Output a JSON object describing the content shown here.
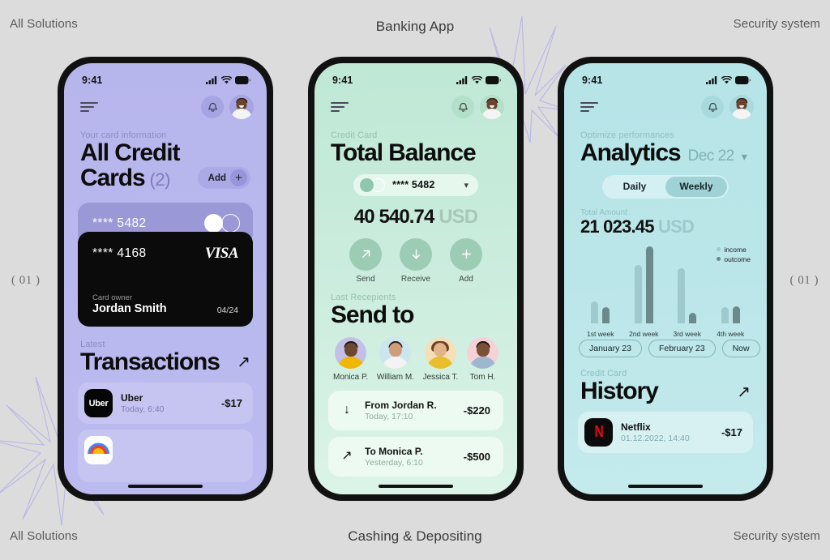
{
  "page": {
    "background": "#dcdcdc",
    "top_left": "All Solutions",
    "top_center": "Banking App",
    "top_right": "Security system",
    "bottom_left": "All Solutions",
    "bottom_center": "Cashing & Depositing",
    "bottom_right": "Security system",
    "index_left": "( 01 )",
    "index_right": "( 01 )"
  },
  "phone1": {
    "status": {
      "time": "9:41"
    },
    "eyebrow": "Your card information",
    "title_line1": "All Credit",
    "title_line2": "Cards",
    "count": "(2)",
    "add_label": "Add",
    "add_icon": "+",
    "card_top": {
      "number": "**** 5482"
    },
    "card_black": {
      "number": "**** 4168",
      "brand": "VISA",
      "owner_label": "Card owner",
      "owner": "Jordan Smith",
      "expiry": "04/24"
    },
    "section_eyebrow": "Latest",
    "section_title": "Transactions",
    "transactions": [
      {
        "name": "Uber",
        "time": "Today, 6:40",
        "amount": "-$17",
        "icon": "uber-logo"
      },
      {
        "name": "",
        "time": "",
        "amount": "",
        "icon": "gpay-logo"
      }
    ]
  },
  "phone2": {
    "status": {
      "time": "9:41"
    },
    "eyebrow": "Credit Card",
    "title": "Total Balance",
    "card_selector": {
      "number": "**** 5482"
    },
    "balance_value": "40 540.74",
    "balance_currency": "USD",
    "actions": [
      {
        "label": "Send",
        "icon": "arrow-up-right-icon"
      },
      {
        "label": "Receive",
        "icon": "arrow-down-icon"
      },
      {
        "label": "Add",
        "icon": "plus-icon"
      }
    ],
    "section_eyebrow": "Last Recepients",
    "section_title": "Send to",
    "recipients": [
      {
        "name": "Monica P."
      },
      {
        "name": "William M."
      },
      {
        "name": "Jessica T."
      },
      {
        "name": "Tom H."
      }
    ],
    "transactions": [
      {
        "arrow": "↓",
        "name": "From Jordan R.",
        "time": "Today, 17:10",
        "amount": "-$220"
      },
      {
        "arrow": "↗",
        "name": "To Monica P.",
        "time": "Yesterday, 6:10",
        "amount": "-$500"
      }
    ]
  },
  "phone3": {
    "status": {
      "time": "9:41"
    },
    "eyebrow": "Optimize performances",
    "title": "Analytics",
    "date": "Dec 22",
    "segments": [
      {
        "label": "Daily",
        "active": false
      },
      {
        "label": "Weekly",
        "active": true
      }
    ],
    "amount_label": "Total Amount",
    "amount_value": "21 023.45",
    "amount_currency": "USD",
    "chips": [
      {
        "label": "January 23"
      },
      {
        "label": "February 23"
      },
      {
        "label": "Now"
      }
    ],
    "section_eyebrow": "Credit Card",
    "section_title": "History",
    "transactions": [
      {
        "name": "Netflix",
        "time": "01.12.2022, 14:40",
        "amount": "-$17",
        "icon": "netflix-logo"
      }
    ]
  },
  "chart_data": {
    "type": "bar",
    "title": "",
    "categories": [
      "1st week",
      "2nd week",
      "3rd week",
      "4th week"
    ],
    "series": [
      {
        "name": "income",
        "color": "#9ec9cd",
        "values": [
          27,
          72,
          68,
          20
        ]
      },
      {
        "name": "outcome",
        "color": "#6b8a8c",
        "values": [
          20,
          95,
          13,
          21
        ]
      }
    ],
    "ylim": [
      0,
      100
    ],
    "grid": false,
    "legend_position": "top-right",
    "xlabel": "",
    "ylabel": ""
  }
}
